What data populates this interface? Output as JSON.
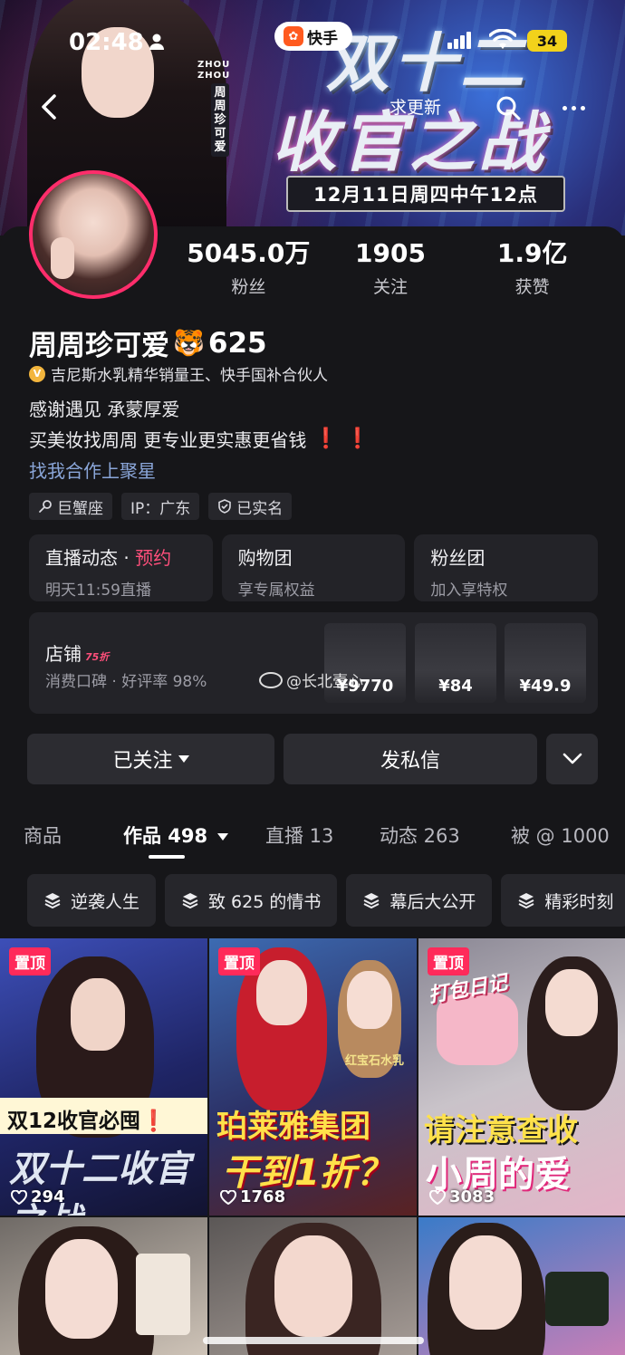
{
  "status_bar": {
    "time": "02:48",
    "battery": "34"
  },
  "app_pill": {
    "label": "快手"
  },
  "nav": {
    "update_label": "求更新"
  },
  "banner": {
    "zhou_tag": "ZHOU\nZHOU",
    "vertical_name": "周周珍可爱",
    "headline_line1": "双十二",
    "headline_line2": "收官之战",
    "date_plate": "12月11日周四中午12点"
  },
  "stats": [
    {
      "num": "5045.0万",
      "label": "粉丝"
    },
    {
      "num": "1905",
      "label": "关注"
    },
    {
      "num": "1.9亿",
      "label": "获赞"
    }
  ],
  "profile": {
    "name": "周周珍可爱",
    "name_emoji": "🐯",
    "name_suffix": "625",
    "verify_text": "吉尼斯水乳精华销量王、快手国补合伙人",
    "bio_line1": "感谢遇见 承蒙厚爱",
    "bio_line2": "买美妆找周周 更专业更实惠更省钱",
    "bio_line2_marks": "❗ ❗",
    "coop_link": "找我合作上聚星"
  },
  "tags": [
    "巨蟹座",
    "IP：广东",
    "已实名"
  ],
  "cards": [
    {
      "title": "直播动态",
      "title_sep": " · ",
      "title_highlight": "预约",
      "sub": "明天11:59直播"
    },
    {
      "title": "购物团",
      "sub": "享专属权益"
    },
    {
      "title": "粉丝团",
      "sub": "加入享特权"
    }
  ],
  "shop": {
    "title": "店铺",
    "badge": "75折",
    "sub": "消费口碑 · 好评率 98%",
    "prices": [
      "¥9770",
      "¥84",
      "¥49.9"
    ]
  },
  "watermark": "@长北壹心",
  "actions": {
    "follow": "已关注",
    "message": "发私信"
  },
  "tabs": [
    {
      "label": "商品"
    },
    {
      "label": "作品 498"
    },
    {
      "label": "直播 13"
    },
    {
      "label": "动态 263"
    },
    {
      "label": "被 @ 1000"
    }
  ],
  "chips": [
    "逆袭人生",
    "致 625 的情书",
    "幕后大公开",
    "精彩时刻"
  ],
  "grid": [
    {
      "pin": "置顶",
      "likes": "294",
      "caption_a": "双12收官必囤❗",
      "caption_b": "双十二收官之战"
    },
    {
      "pin": "置顶",
      "likes": "1768",
      "caption_a": "珀莱雅集团",
      "caption_b": "干到1折？",
      "tag": "红宝石水乳"
    },
    {
      "pin": "置顶",
      "likes": "3083",
      "caption_a": "请注意查收",
      "caption_b": "小周的爱",
      "tag": "打包日记"
    },
    {
      "caption_a": ""
    },
    {
      "caption_a": ""
    },
    {
      "caption_a": ""
    }
  ],
  "colors": {
    "accent_pink": "#ff2d6b",
    "link_blue": "#8aa6d9",
    "battery_yellow": "#f2d21b",
    "background": "#161619"
  }
}
